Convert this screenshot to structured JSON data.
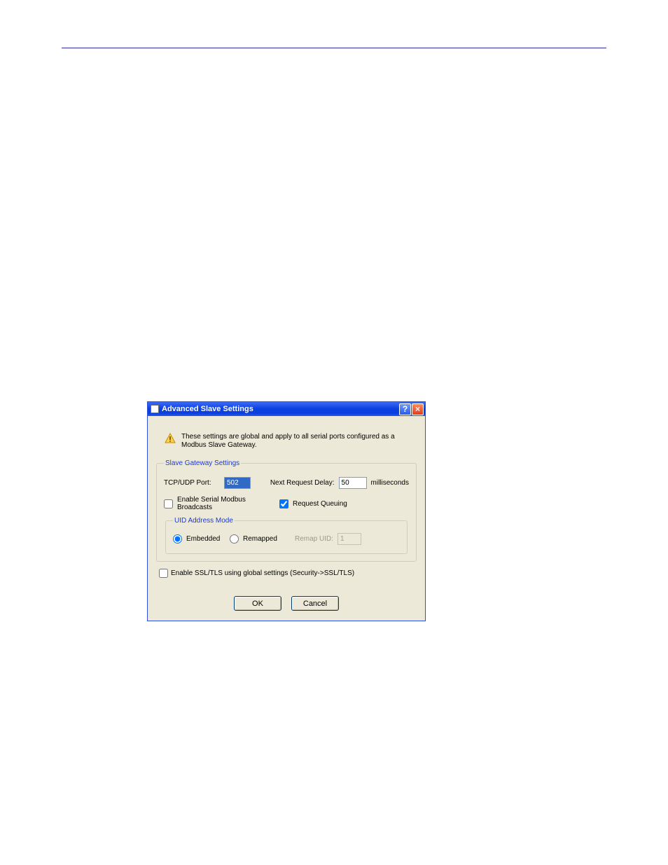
{
  "titlebar": {
    "title": "Advanced Slave Settings",
    "help_symbol": "?",
    "close_symbol": "×"
  },
  "info": {
    "text": "These settings are global and apply to all serial ports configured as a Modbus Slave Gateway."
  },
  "group": {
    "slave_gateway_legend": "Slave Gateway Settings",
    "tcp_udp_port_label": "TCP/UDP Port:",
    "tcp_udp_port_value": "502",
    "next_request_delay_label": "Next Request Delay:",
    "next_request_delay_value": "50",
    "next_request_delay_units": "milliseconds",
    "enable_broadcasts_label": "Enable Serial Modbus Broadcasts",
    "enable_broadcasts_checked": false,
    "request_queuing_label": "Request Queuing",
    "request_queuing_checked": true,
    "uid_mode_legend": "UID Address Mode",
    "embedded_label": "Embedded",
    "remapped_label": "Remapped",
    "uid_mode_selected": "embedded",
    "remap_uid_label": "Remap UID:",
    "remap_uid_value": "1"
  },
  "ssl": {
    "label": "Enable SSL/TLS using global settings (Security->SSL/TLS)",
    "checked": false
  },
  "buttons": {
    "ok": "OK",
    "cancel": "Cancel"
  }
}
